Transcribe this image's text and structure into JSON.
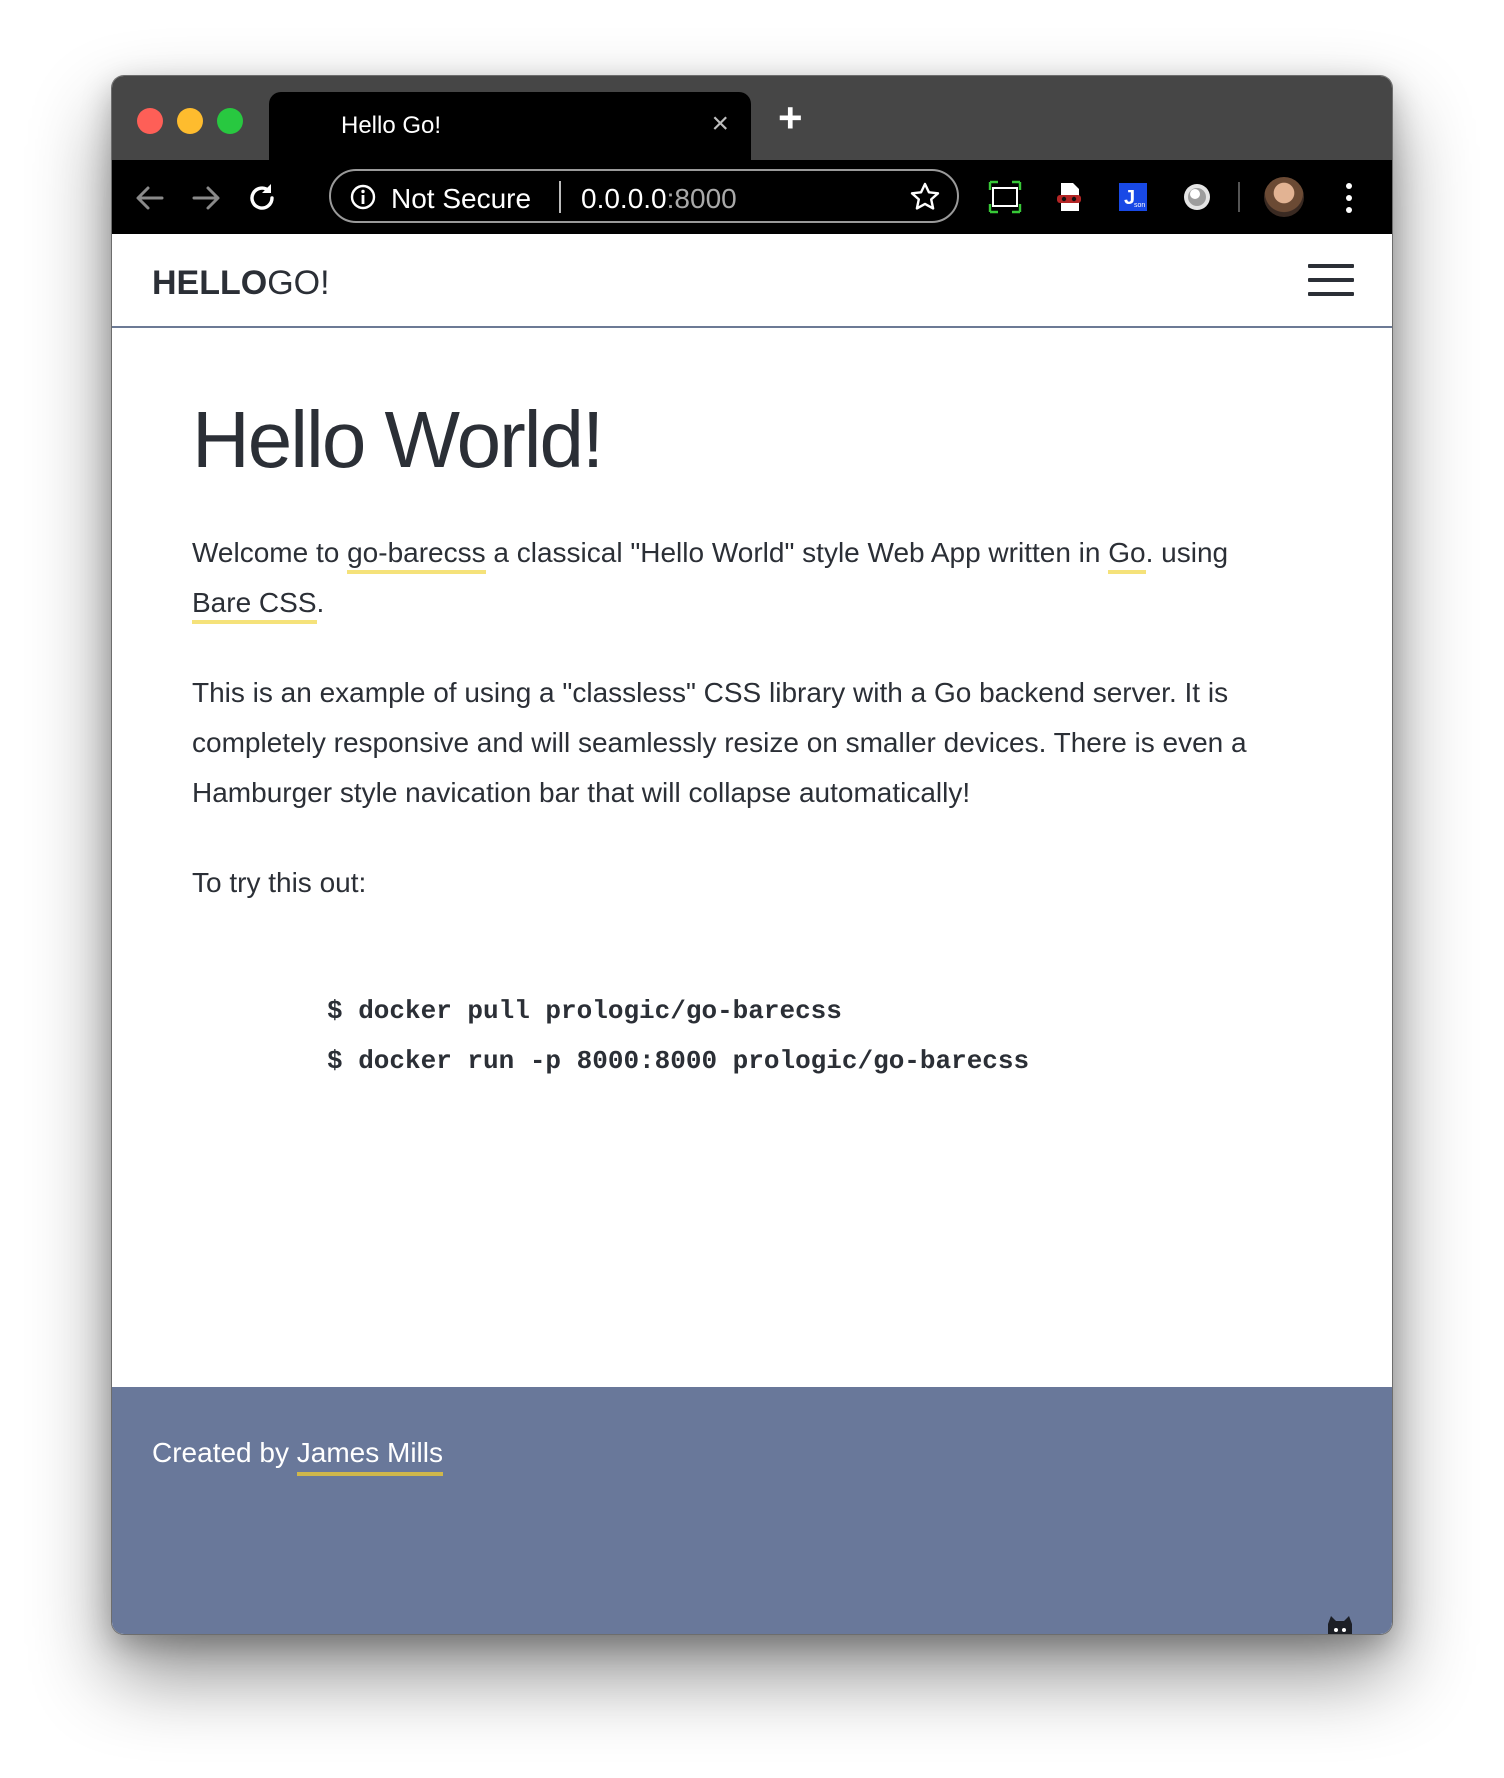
{
  "browser": {
    "tab_title": "Hello Go!",
    "security_text": "Not Secure",
    "url_host": "0.0.0.0",
    "url_port": ":8000",
    "new_tab_glyph": "+",
    "close_glyph": "×"
  },
  "site": {
    "brand_bold": "HELLO",
    "brand_rest": "GO!",
    "heading": "Hello World!",
    "intro": {
      "t1": "Welcome to ",
      "link1": "go-barecss",
      "t2": " a classical \"Hello World\" style Web App written in ",
      "link2": "Go",
      "t3": ". using ",
      "link3": "Bare CSS",
      "t4": "."
    },
    "paragraph2": "This is an example of using a \"classless\" CSS library with a Go backend server. It is completely responsive and will seamlessly resize on smaller devices. There is even a Hamburger style navication bar that will collapse automatically!",
    "paragraph3": "To try this out:",
    "code_line1": "$ docker pull prologic/go-barecss",
    "code_line2": "$ docker run -p 8000:8000 prologic/go-barecss",
    "footer_text": "Created by ",
    "footer_link": "James Mills"
  },
  "icons": [
    "back-arrow-icon",
    "forward-arrow-icon",
    "reload-icon",
    "info-icon",
    "star-icon",
    "screenshot-extension-icon",
    "privacy-extension-icon",
    "json-extension-icon",
    "circle-extension-icon",
    "menu-dots-icon",
    "hamburger-icon",
    "github-icon"
  ],
  "colors": {
    "footer_bg": "#69789a",
    "link_underline": "#f5e27a",
    "text": "#2b2f36"
  }
}
